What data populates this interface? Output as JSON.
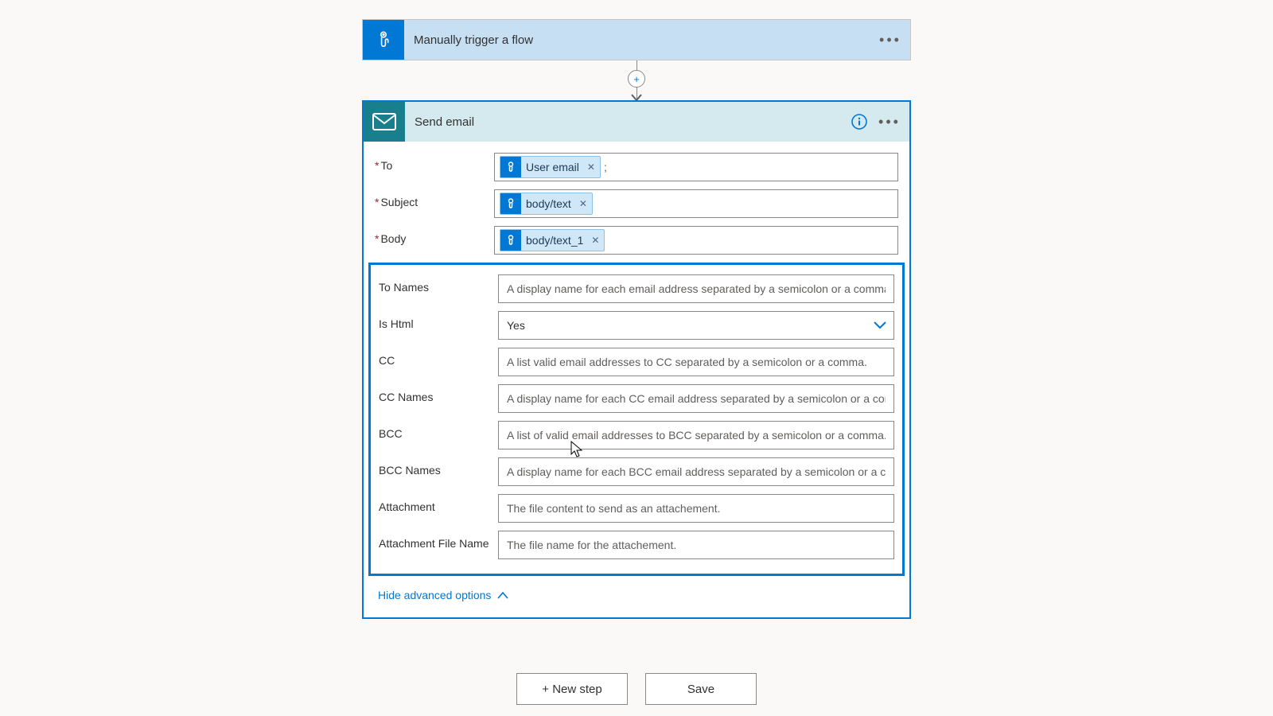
{
  "trigger": {
    "title": "Manually trigger a flow"
  },
  "action": {
    "title": "Send email",
    "toggle_advanced_label": "Hide advanced options",
    "fields": {
      "to_label": "To",
      "subject_label": "Subject",
      "body_label": "Body",
      "to_names_label": "To Names",
      "is_html_label": "Is Html",
      "is_html_value": "Yes",
      "cc_label": "CC",
      "cc_names_label": "CC Names",
      "bcc_label": "BCC",
      "bcc_names_label": "BCC Names",
      "attachment_label": "Attachment",
      "attachment_filename_label": "Attachment File Name"
    },
    "placeholders": {
      "to_names": "A display name for each email address separated by a semicolon or a comma.",
      "cc": "A list valid email addresses to CC separated by a semicolon or a comma.",
      "cc_names": "A display name for each CC email address separated by a semicolon or a comma.",
      "bcc": "A list of valid email addresses to BCC separated by a semicolon or a comma.",
      "bcc_names": "A display name for each BCC email address separated by a semicolon or a comma.",
      "attachment": "The file content to send as an attachement.",
      "attachment_filename": "The file name for the attachement."
    },
    "tokens": {
      "to": "User email",
      "subject": "body/text",
      "body": "body/text_1"
    },
    "to_suffix": ";"
  },
  "footer": {
    "new_step": "+ New step",
    "save": "Save"
  }
}
